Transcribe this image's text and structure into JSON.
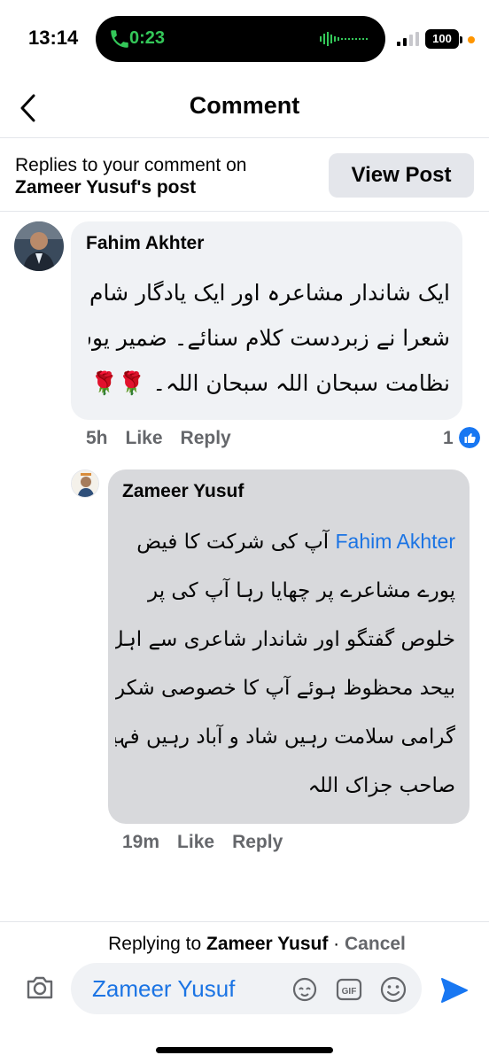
{
  "status_bar": {
    "time": "13:14",
    "call_timer": "0:23",
    "battery": "100"
  },
  "header": {
    "title": "Comment"
  },
  "banner": {
    "text_prefix": "Replies to your comment on",
    "post_owner": "Zameer Yusuf",
    "text_suffix": "'s post",
    "view_post": "View Post"
  },
  "comments": [
    {
      "author": "Fahim Akhter",
      "lines": [
        "ایک شاندار مشاعرہ اور ایک یادگار شام ۔ تمام",
        "شعرا نے زبردست کلام سنائے۔ ضمیر یوسف کی",
        "نظامت سبحان اللہ سبحان اللہ۔ 🌹🌹"
      ],
      "time": "5h",
      "like": "Like",
      "reply": "Reply",
      "reaction_count": "1"
    },
    {
      "author": "Zameer Yusuf",
      "mention": "Fahim Akhter",
      "lines": [
        "آپ کی شرکت کا فیض",
        "پورے مشاعرے پر چھایا رہا آپ کی پر",
        "خلوص گفتگو اور شاندار شاعری سے اہل بزم",
        "بیحد محظوظ ہوئے آپ کا خصوصی شکریہ برادر",
        "گرامی سلامت رہیں شاد و آباد رہیں فہیم اختر",
        "صاحب جزاک اللہ"
      ],
      "time": "19m",
      "like": "Like",
      "reply": "Reply"
    }
  ],
  "composer": {
    "replying_prefix": "Replying to",
    "replying_to": "Zameer Yusuf",
    "separator": " · ",
    "cancel": "Cancel",
    "input_value": "Zameer Yusuf"
  },
  "colors": {
    "accent": "#1b74e4",
    "call_green": "#34c759",
    "muted": "#65676b",
    "bubble": "#f0f2f5",
    "bubble_selected": "#d8d9dc"
  },
  "icons": [
    "back-icon",
    "camera-icon",
    "avatar-sticker-icon",
    "gif-icon",
    "emoji-icon",
    "send-icon",
    "like-reaction-icon",
    "phone-icon"
  ]
}
